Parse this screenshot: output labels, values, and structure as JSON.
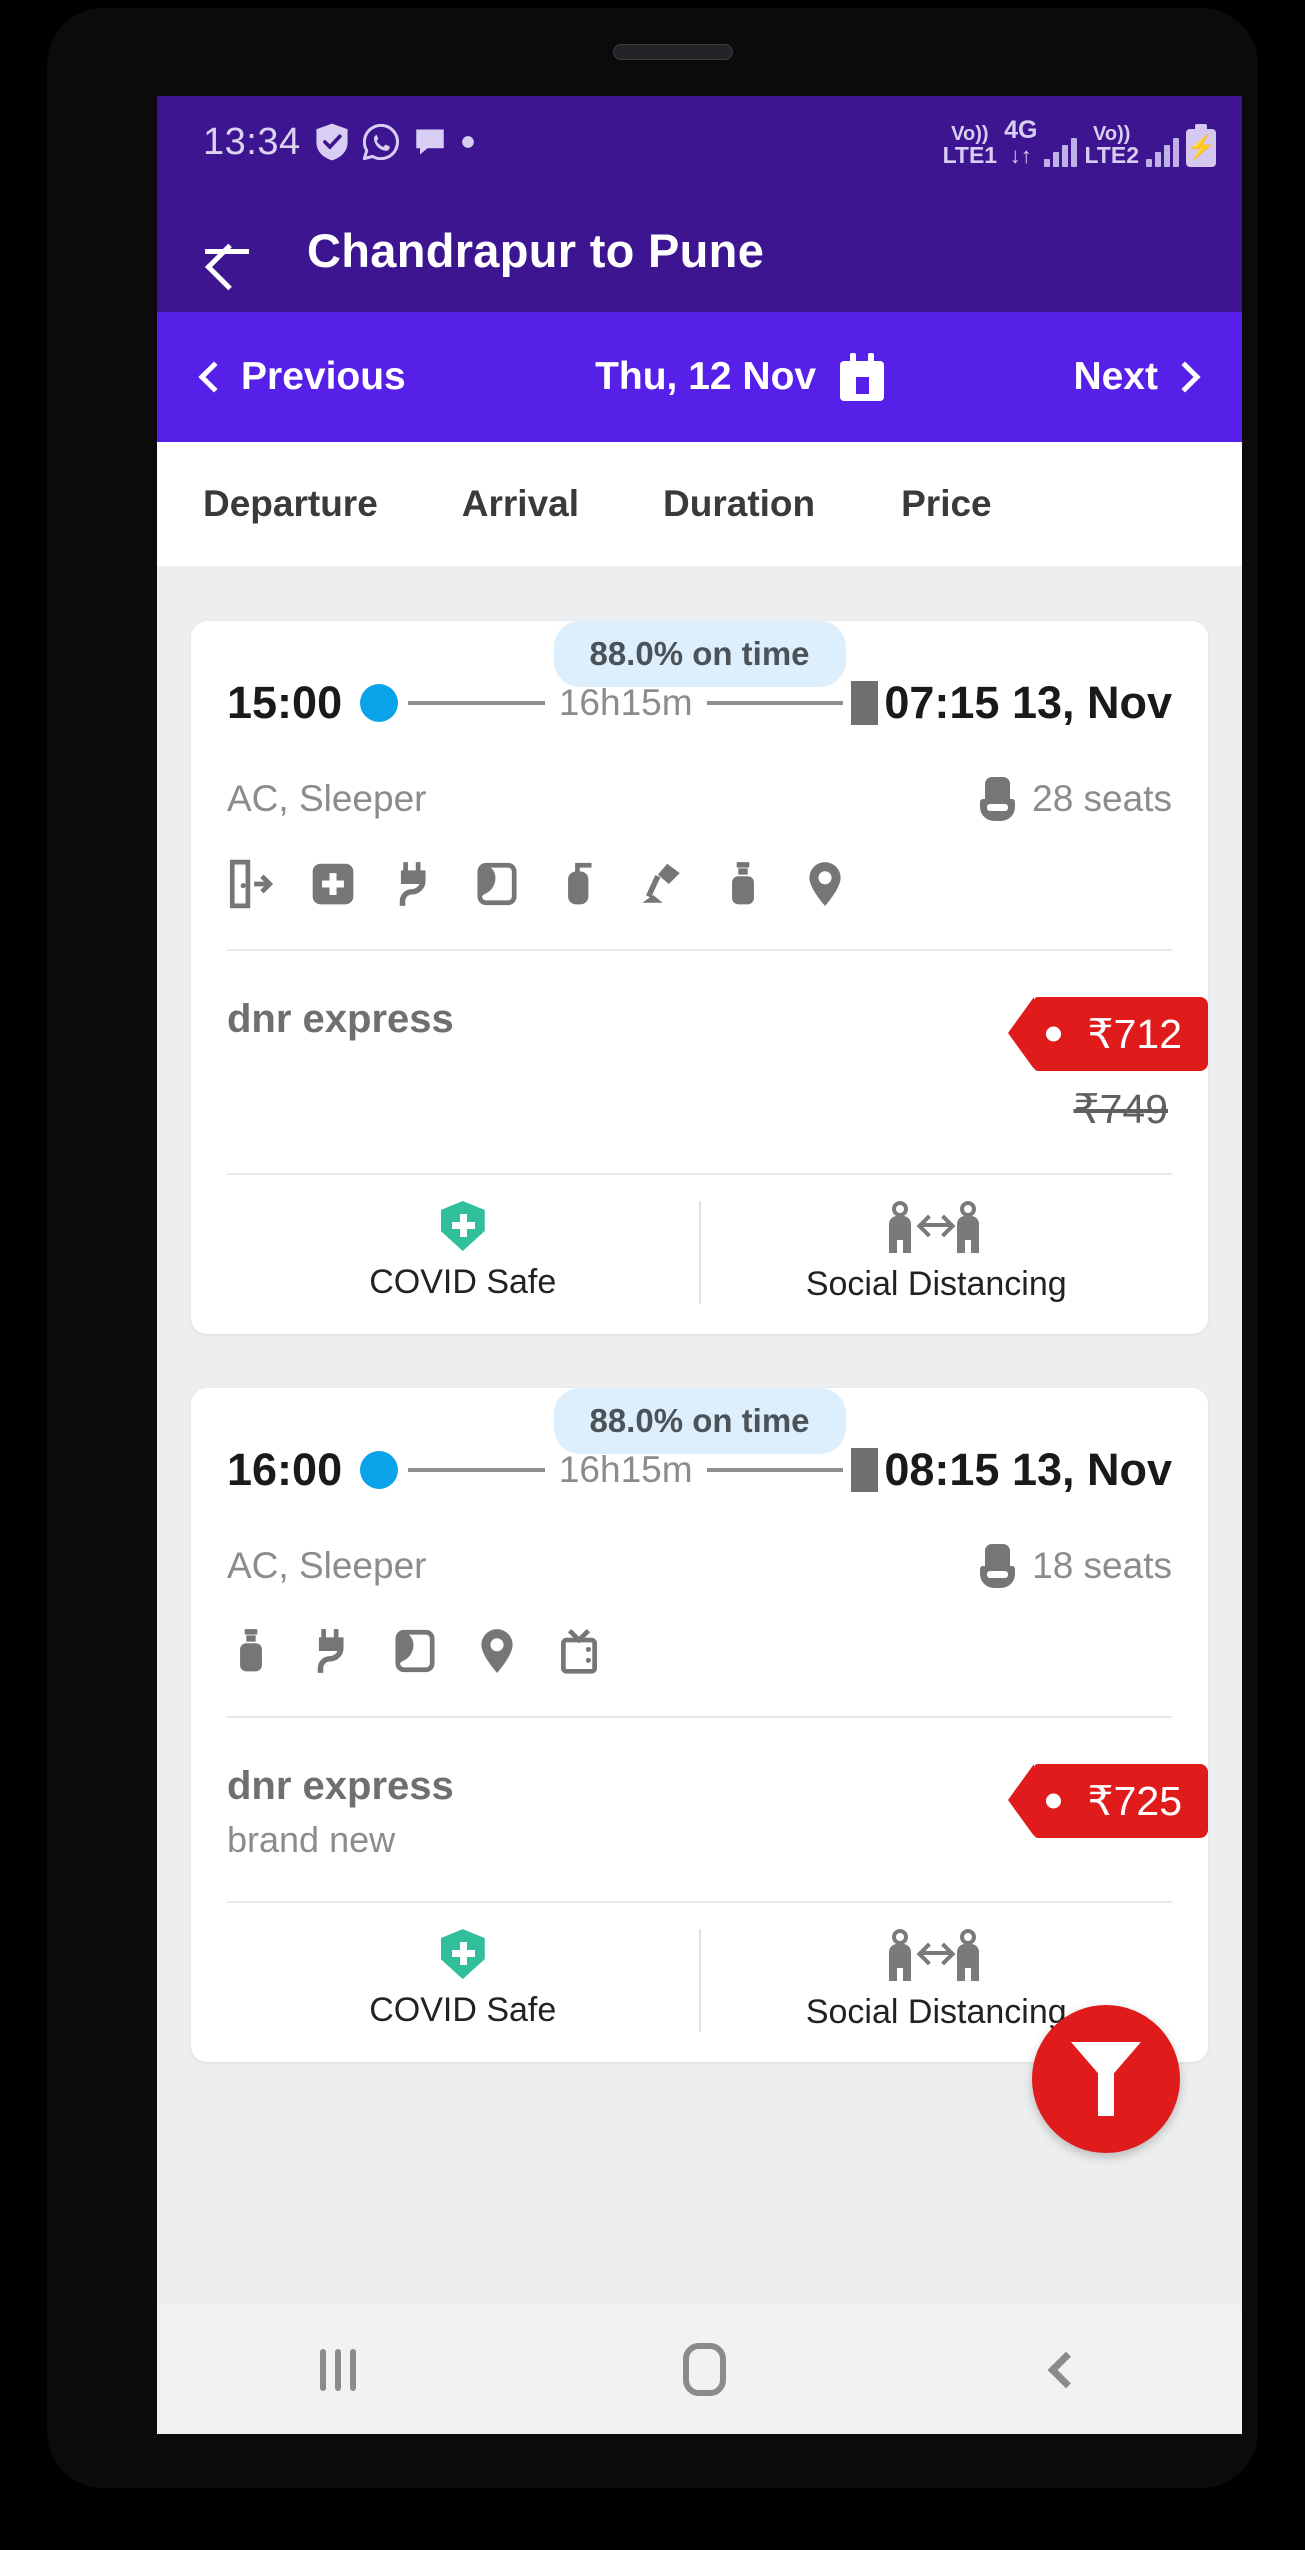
{
  "status_bar": {
    "time": "13:34",
    "left_icons": [
      "shield-check-icon",
      "whatsapp-icon",
      "message-icon",
      "dot-icon"
    ],
    "sim1_top": "Vo))",
    "sim1_bottom": "LTE1",
    "network": "4G",
    "network_arrows": "↓↑",
    "sim2_top": "Vo))",
    "sim2_bottom": "LTE2",
    "battery_icon": "charging-battery-icon"
  },
  "app_bar": {
    "back_icon": "back-arrow-icon",
    "title": "Chandrapur to Pune",
    "bg_color": "#3d1590"
  },
  "date_bar": {
    "previous_label": "Previous",
    "date_label": "Thu, 12 Nov",
    "next_label": "Next",
    "calendar_icon": "calendar-icon",
    "bg_color": "#5720e8"
  },
  "sort_bar": {
    "options": [
      "Departure",
      "Arrival",
      "Duration",
      "Price"
    ]
  },
  "buses": [
    {
      "on_time": "88.0% on time",
      "departure_time": "15:00",
      "duration": "16h15m",
      "arrival_time": "07:15 13, Nov",
      "bus_type": "AC, Sleeper",
      "seats": "28 seats",
      "amenities": [
        "emergency-exit-icon",
        "first-aid-kit-icon",
        "charging-point-icon",
        "blanket-icon",
        "fire-extinguisher-icon",
        "reading-light-icon",
        "water-bottle-icon",
        "live-tracking-icon"
      ],
      "operator": "dnr express",
      "operator_sub": "",
      "price": "₹712",
      "price_old": "₹749",
      "safety": [
        {
          "icon": "covid-shield-icon",
          "label": "COVID Safe"
        },
        {
          "icon": "social-distancing-icon",
          "label": "Social Distancing"
        }
      ]
    },
    {
      "on_time": "88.0% on time",
      "departure_time": "16:00",
      "duration": "16h15m",
      "arrival_time": "08:15 13, Nov",
      "bus_type": "AC, Sleeper",
      "seats": "18 seats",
      "amenities": [
        "water-bottle-icon",
        "charging-point-icon",
        "blanket-icon",
        "live-tracking-icon",
        "television-icon"
      ],
      "operator": "dnr express",
      "operator_sub": "brand new",
      "price": "₹725",
      "price_old": "",
      "safety": [
        {
          "icon": "covid-shield-icon",
          "label": "COVID Safe"
        },
        {
          "icon": "social-distancing-icon",
          "label": "Social Distancing"
        }
      ]
    }
  ],
  "filter_fab": {
    "icon": "filter-funnel-icon",
    "color": "#e01b1b"
  },
  "bottom_nav": {
    "recents_icon": "recents-icon",
    "home_icon": "home-icon",
    "back_icon": "back-icon"
  }
}
